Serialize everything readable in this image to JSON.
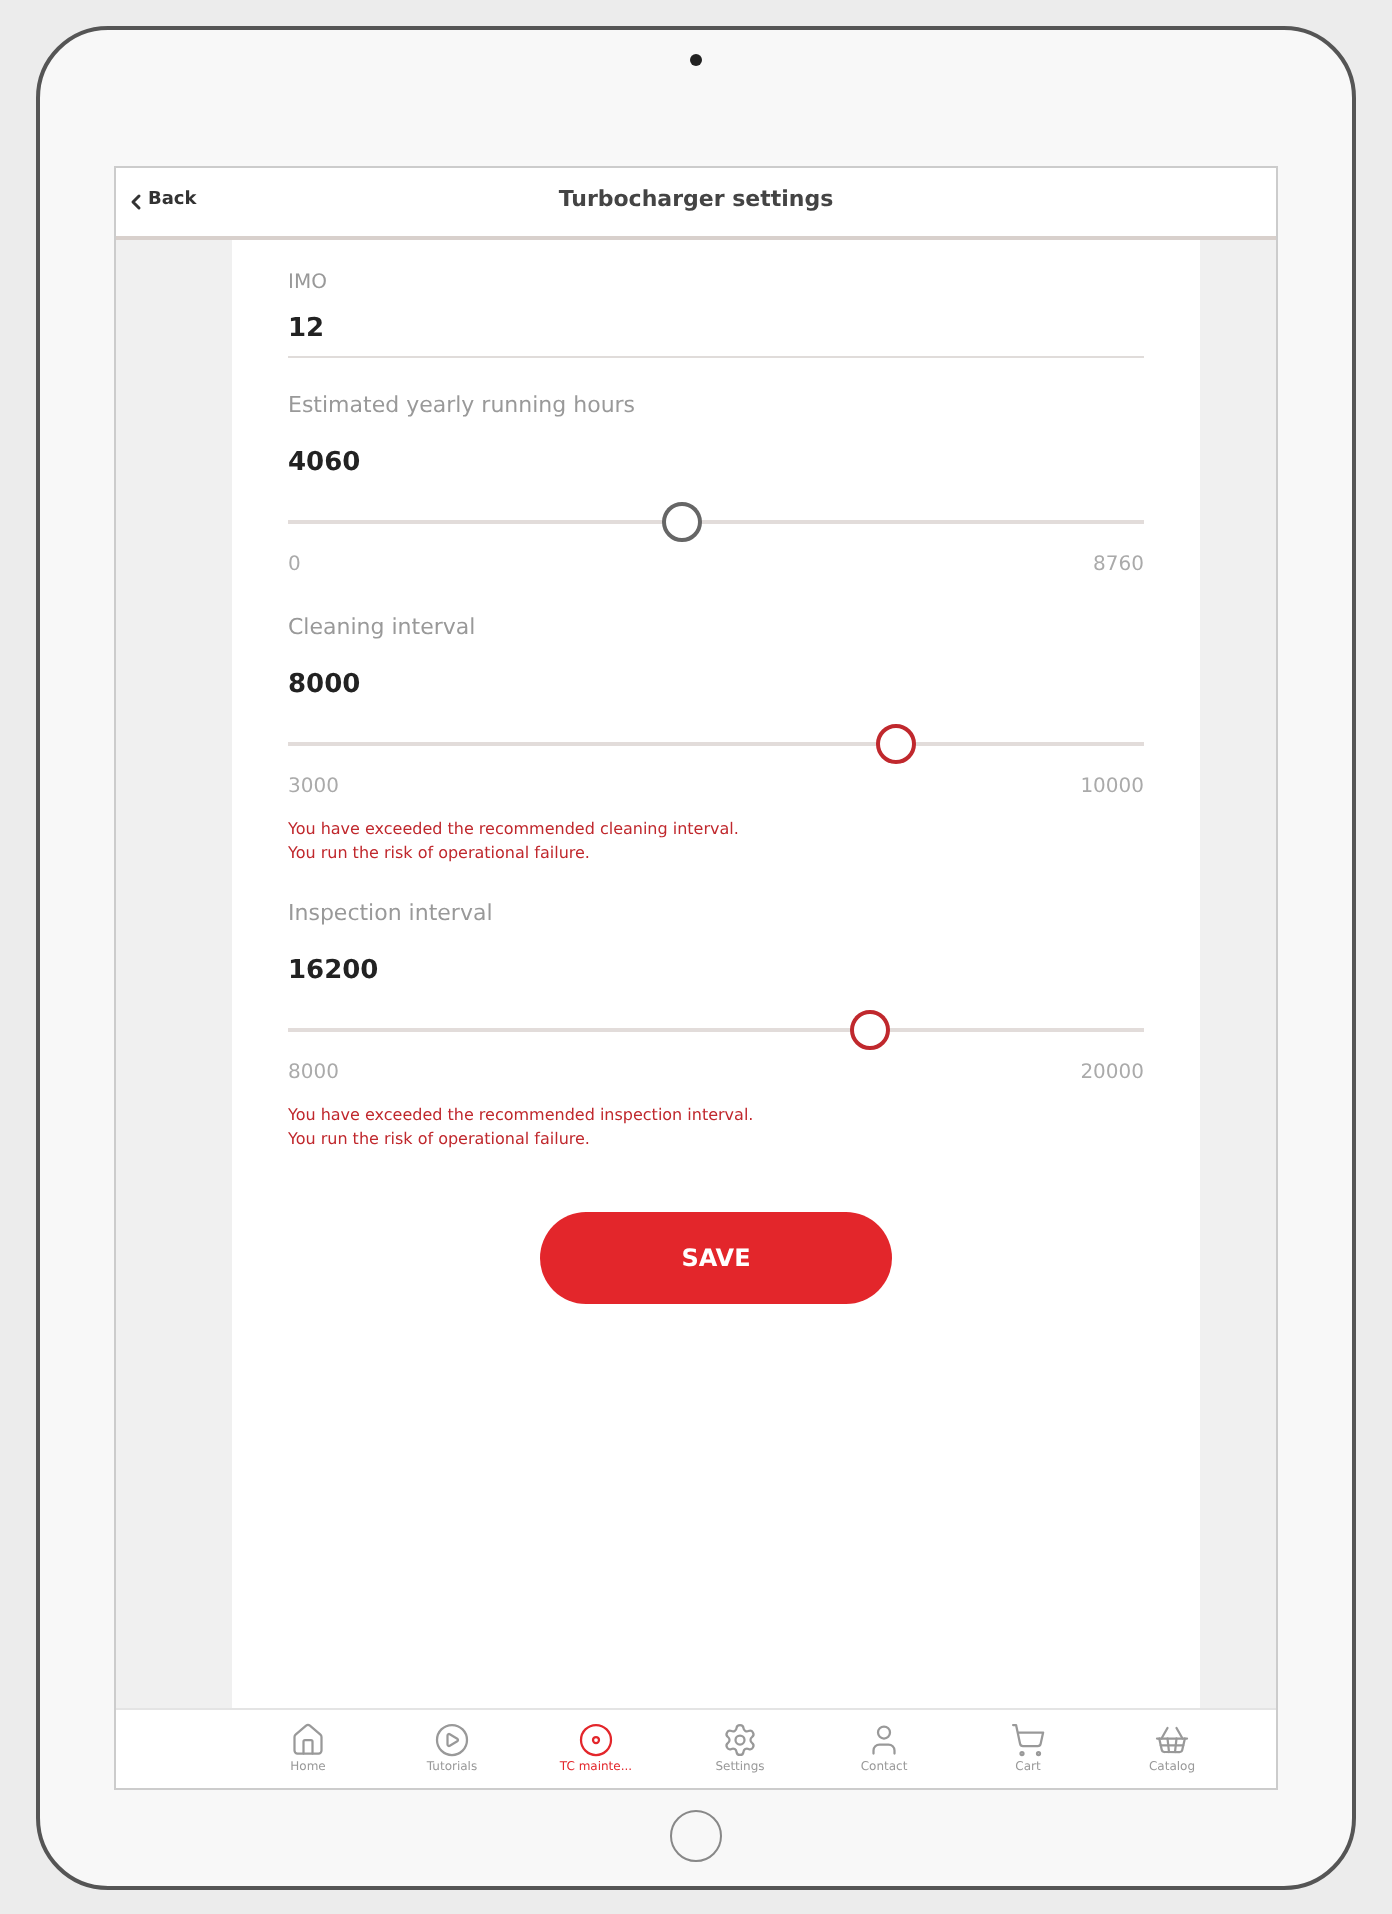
{
  "header": {
    "back": "Back",
    "title": "Turbocharger settings"
  },
  "imo": {
    "label": "IMO",
    "value": "12"
  },
  "sliders": [
    {
      "label": "Estimated yearly running hours",
      "value": "4060",
      "level": 0.46,
      "min": "0",
      "max": "8760",
      "warning": false
    },
    {
      "label": "Cleaning interval",
      "value": "8000",
      "level": 0.71,
      "min": "3000",
      "max": "10000",
      "warning": true,
      "message": [
        "You have exceeded the recommended cleaning interval.",
        "You run the risk of operational failure."
      ]
    },
    {
      "label": "Inspection interval",
      "value": "16200",
      "level": 0.68,
      "min": "8000",
      "max": "20000",
      "warning": true,
      "message": [
        "You have exceeded the recommended inspection interval.",
        "You run the risk of operational failure."
      ]
    }
  ],
  "save": "SAVE",
  "tabs": [
    {
      "kind": "home",
      "label": "Home",
      "selected": false
    },
    {
      "kind": "tutorials",
      "label": "Tutorials",
      "selected": false
    },
    {
      "kind": "maintenance",
      "label": "TC mainte...",
      "selected": true
    },
    {
      "kind": "settings",
      "label": "Settings",
      "selected": false
    },
    {
      "kind": "contact",
      "label": "Contact",
      "selected": false
    },
    {
      "kind": "cart",
      "label": "Cart",
      "selected": false
    },
    {
      "kind": "catalog",
      "label": "Catalog",
      "selected": false
    }
  ]
}
